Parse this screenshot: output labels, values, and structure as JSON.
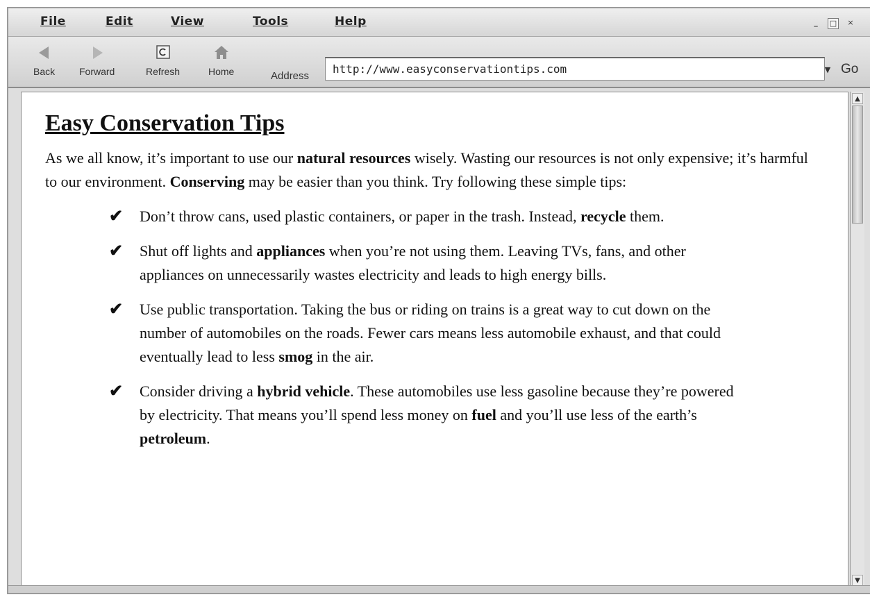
{
  "menu": {
    "file": "File",
    "edit": "Edit",
    "view": "View",
    "tools": "Tools",
    "help": "Help"
  },
  "window_controls": {
    "minimize": "_",
    "maximize": "□",
    "close": "×"
  },
  "toolbar": {
    "back": "Back",
    "forward": "Forward",
    "refresh": "Refresh",
    "home": "Home",
    "address_label": "Address",
    "address_value": "http://www.easyconservationtips.com",
    "go": "Go"
  },
  "icons": {
    "back": "back-arrow-icon",
    "forward": "forward-arrow-icon",
    "refresh": "refresh-icon",
    "home": "home-icon",
    "dropdown": "dropdown-arrow-icon",
    "check": "checkmark-icon"
  },
  "page": {
    "title": "Easy Conservation Tips",
    "intro": {
      "t1": "As we all know, it’s important to use our ",
      "b1": "natural resources",
      "t2": " wisely. Wasting our resources is not only expensive; it’s harmful to our environment. ",
      "b2": "Conserving",
      "t3": " may be easier than you think. Try following these simple tips:"
    },
    "tips": [
      {
        "t1": "Don’t throw cans, used plastic containers, or paper in the trash. Instead, ",
        "b1": "recycle",
        "t2": " them."
      },
      {
        "t1": "Shut off lights and ",
        "b1": "appliances",
        "t2": " when you’re not using them. Leaving TVs, fans, and other appliances on unnecessarily wastes electricity and leads to high energy bills."
      },
      {
        "t1": "Use public transportation. Taking the bus or riding on trains is a great way to cut down on the number of automobiles on the roads. Fewer cars means less automobile exhaust, and that could eventually lead to less ",
        "b1": "smog",
        "t2": " in the air."
      },
      {
        "t1": "Consider driving a ",
        "b1": "hybrid vehicle",
        "t2": ". These automobiles use less gasoline because they’re powered by electricity. That means you’ll spend less money on ",
        "b2": "fuel",
        "t3": " and you’ll use less of the earth’s ",
        "b3": "petroleum",
        "t4": "."
      }
    ]
  },
  "colors": {
    "chrome": "#dedede",
    "page_bg": "#ffffff",
    "text": "#111111"
  }
}
